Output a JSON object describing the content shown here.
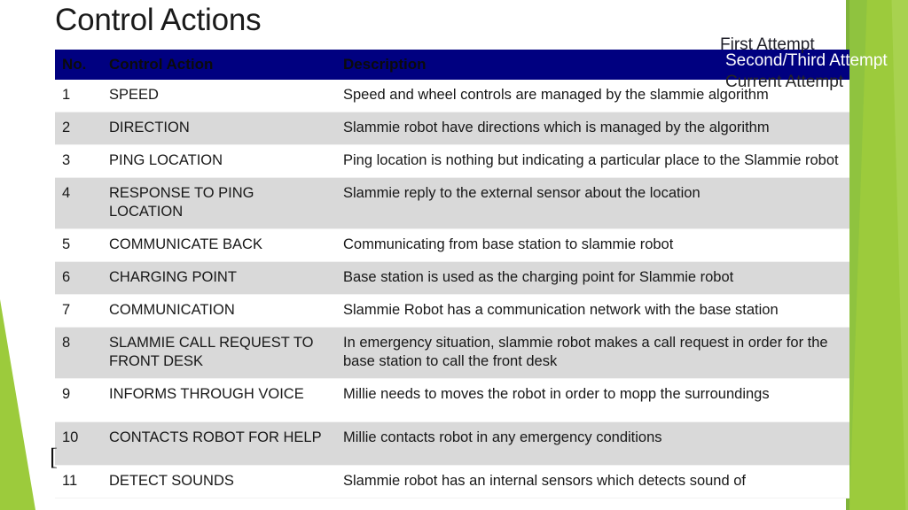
{
  "slide": {
    "title": "Control Actions",
    "stray_glyph": "["
  },
  "theme": {
    "header_bg": "#000080",
    "row_shaded_bg": "#d9d9d9",
    "row_plain_bg": "#ffffff",
    "accent_green": "#9ccb3c",
    "accent_green_dark": "#8fc33f",
    "text_color": "#181818"
  },
  "table": {
    "name": "control-actions-table",
    "columns": [
      {
        "key": "no",
        "label": "No."
      },
      {
        "key": "action",
        "label": "Control Action"
      },
      {
        "key": "description",
        "label": "Description"
      }
    ],
    "header_combined_label": "No. Control Action",
    "rows": [
      {
        "no": "1",
        "action": "SPEED",
        "description": "Speed and wheel controls are managed by the slammie algorithm"
      },
      {
        "no": "2",
        "action": "DIRECTION",
        "description": "Slammie robot have directions which is managed by the algorithm"
      },
      {
        "no": "3",
        "action": "PING LOCATION",
        "description": "Ping location is nothing but indicating a particular place to the Slammie robot"
      },
      {
        "no": "4",
        "action": "RESPONSE TO PING LOCATION",
        "description": "Slammie reply to the external sensor about the location"
      },
      {
        "no": "5",
        "action": "COMMUNICATE BACK",
        "description": "Communicating from base station to slammie robot"
      },
      {
        "no": "6",
        "action": "CHARGING POINT",
        "description": "Base station is used as the charging point for Slammie robot"
      },
      {
        "no": "7",
        "action": "COMMUNICATION",
        "description": "Slammie Robot has a communication network with the base station"
      },
      {
        "no": "8",
        "action": "SLAMMIE CALL REQUEST TO FRONT DESK",
        "description": "In emergency situation, slammie robot makes a call request in order for the base station to call the front desk"
      },
      {
        "no": "9",
        "action": "INFORMS THROUGH VOICE",
        "description": "Millie needs to moves the robot in order to mopp the surroundings"
      },
      {
        "no": "10",
        "action": "CONTACTS ROBOT FOR HELP",
        "description": "Millie contacts robot in any emergency conditions"
      },
      {
        "no": "11",
        "action": "DETECT SOUNDS",
        "description": "Slammie robot has an internal sensors which detects sound of"
      }
    ]
  },
  "overlay": {
    "first_attempt": "First Attempt",
    "second_third_attempt": "Second/Third Attempt",
    "current_attempt": "Current Attempt"
  }
}
